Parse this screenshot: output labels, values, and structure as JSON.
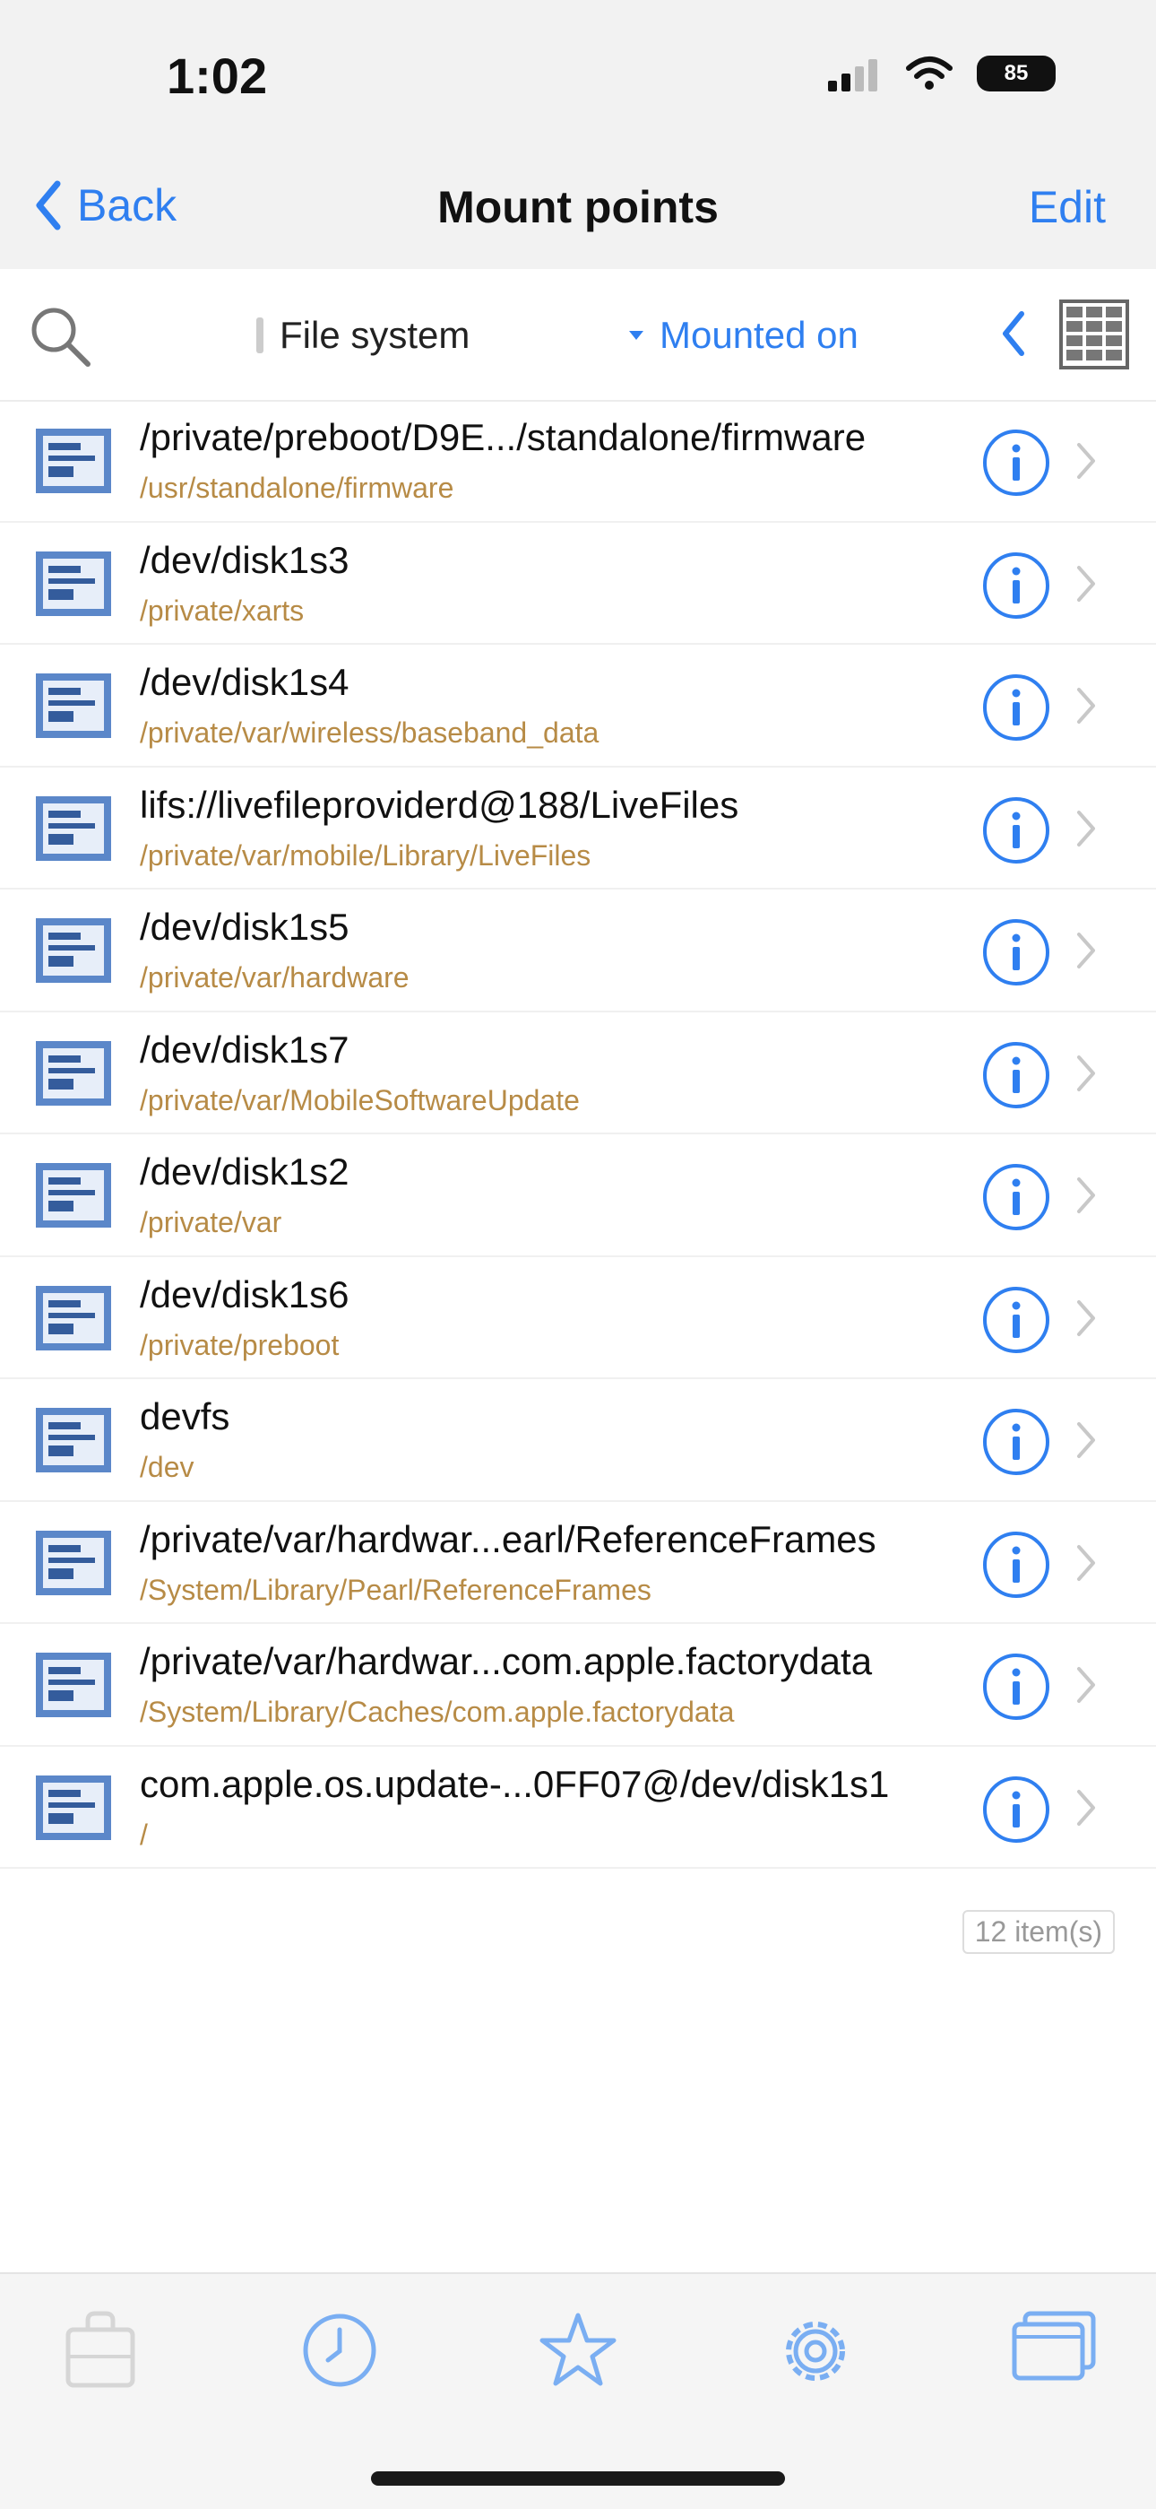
{
  "status": {
    "time": "1:02",
    "battery": "85"
  },
  "nav": {
    "back_label": "Back",
    "title": "Mount points",
    "edit_label": "Edit"
  },
  "toolbar": {
    "fs_column": "File system",
    "mount_column": "Mounted on"
  },
  "rows": [
    {
      "fs": "/private/preboot/D9E.../standalone/firmware",
      "mount": "/usr/standalone/firmware"
    },
    {
      "fs": "/dev/disk1s3",
      "mount": "/private/xarts"
    },
    {
      "fs": "/dev/disk1s4",
      "mount": "/private/var/wireless/baseband_data"
    },
    {
      "fs": "lifs://livefileproviderd@188/LiveFiles",
      "mount": "/private/var/mobile/Library/LiveFiles"
    },
    {
      "fs": "/dev/disk1s5",
      "mount": "/private/var/hardware"
    },
    {
      "fs": "/dev/disk1s7",
      "mount": "/private/var/MobileSoftwareUpdate"
    },
    {
      "fs": "/dev/disk1s2",
      "mount": "/private/var"
    },
    {
      "fs": "/dev/disk1s6",
      "mount": "/private/preboot"
    },
    {
      "fs": "devfs",
      "mount": "/dev"
    },
    {
      "fs": "/private/var/hardwar...earl/ReferenceFrames",
      "mount": "/System/Library/Pearl/ReferenceFrames"
    },
    {
      "fs": "/private/var/hardwar...com.apple.factorydata",
      "mount": "/System/Library/Caches/com.apple.factorydata"
    },
    {
      "fs": "com.apple.os.update-...0FF07@/dev/disk1s1",
      "mount": "/"
    }
  ],
  "footer": {
    "count": "12 item(s)"
  },
  "tabs": [
    {
      "name": "tab-bag",
      "icon": "bag-icon"
    },
    {
      "name": "tab-recent",
      "icon": "clock-icon"
    },
    {
      "name": "tab-favorites",
      "icon": "star-icon"
    },
    {
      "name": "tab-settings",
      "icon": "gear-icon"
    },
    {
      "name": "tab-windows",
      "icon": "windows-icon"
    }
  ],
  "colors": {
    "accent": "#2f7ff0",
    "mount_text": "#b78b46",
    "bar_bg": "#f2f2f2"
  }
}
